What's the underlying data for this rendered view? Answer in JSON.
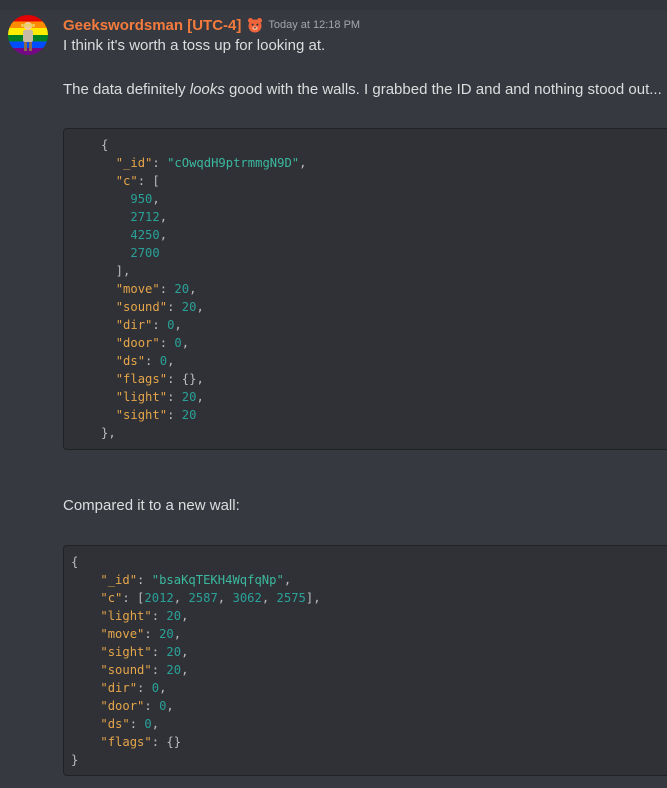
{
  "author": {
    "name": "Geekswordsman [UTC-4]",
    "timestamp": "Today at 12:18 PM",
    "badge_icon": "bear-badge-icon",
    "name_color": "#f47b3d"
  },
  "message": {
    "line1": "I think it's worth a toss up for looking at.",
    "line2_pre": "The data definitely ",
    "line2_em": "looks",
    "line2_post": " good with the walls.  I grabbed the ID and and nothing stood out...",
    "line3": "Compared it to a new wall:"
  },
  "code1": {
    "open": "{",
    "id_key": "\"_id\"",
    "id_val": "\"cOwqdH9ptrmmgN9D\"",
    "c_key": "\"c\"",
    "c_vals": [
      "950",
      "2712",
      "4250",
      "2700"
    ],
    "move_key": "\"move\"",
    "move_val": "20",
    "sound_key": "\"sound\"",
    "sound_val": "20",
    "dir_key": "\"dir\"",
    "dir_val": "0",
    "door_key": "\"door\"",
    "door_val": "0",
    "ds_key": "\"ds\"",
    "ds_val": "0",
    "flags_key": "\"flags\"",
    "flags_val": "{}",
    "light_key": "\"light\"",
    "light_val": "20",
    "sight_key": "\"sight\"",
    "sight_val": "20",
    "close": "},"
  },
  "code2": {
    "open": "{",
    "id_key": "\"_id\"",
    "id_val": "\"bsaKqTEKH4WqfqNp\"",
    "c_key": "\"c\"",
    "c_vals": [
      "2012",
      "2587",
      "3062",
      "2575"
    ],
    "light_key": "\"light\"",
    "light_val": "20",
    "move_key": "\"move\"",
    "move_val": "20",
    "sight_key": "\"sight\"",
    "sight_val": "20",
    "sound_key": "\"sound\"",
    "sound_val": "20",
    "dir_key": "\"dir\"",
    "dir_val": "0",
    "door_key": "\"door\"",
    "door_val": "0",
    "ds_key": "\"ds\"",
    "ds_val": "0",
    "flags_key": "\"flags\"",
    "flags_val": "{}",
    "close": "}"
  }
}
